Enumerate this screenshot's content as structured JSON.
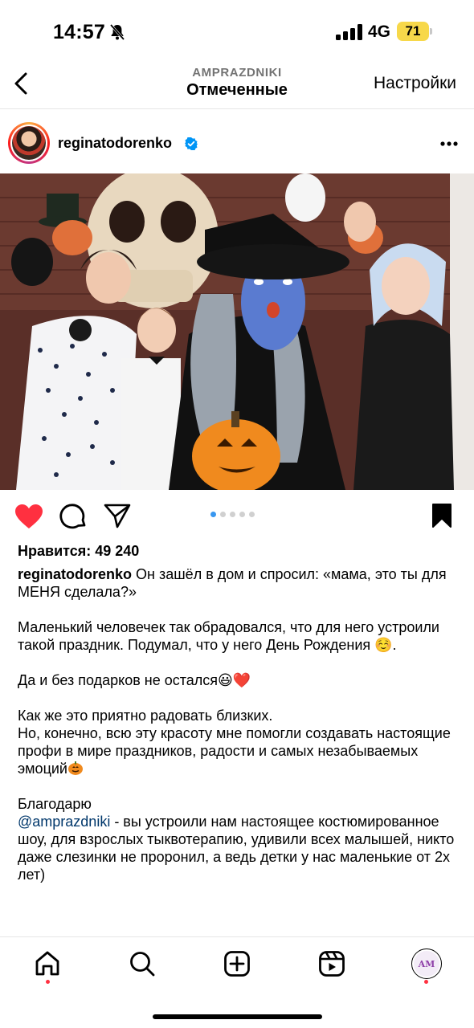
{
  "status_bar": {
    "time": "14:57",
    "network": "4G",
    "battery_level": "71",
    "icons": [
      "bell-slash-icon",
      "signal-bars-icon",
      "battery-icon"
    ],
    "battery_color": "#f7d84a"
  },
  "nav": {
    "subtitle": "AMPRAZDNIKI",
    "title": "Отмеченные",
    "settings_label": "Настройки"
  },
  "post": {
    "username": "reginatodorenko",
    "verified": true,
    "image_carousel": {
      "count": 5,
      "active_index": 0
    },
    "likes_text": "Нравится: 49 240",
    "caption_first": "Он зашёл в дом и спросил: «мама, это ты для МЕНЯ сделала?»",
    "caption_p2": "Маленький человечек так обрадовался, что для него устроили такой праздник. Подумал, что у него День Рождения ☺️.",
    "caption_p3": "Да и без подарков не остался😃❤️",
    "caption_p4_line1": "Как же это приятно радовать близких.",
    "caption_p4_line2": "Но, конечно, всю эту красоту мне помогли создавать настоящие профи в мире праздников, радости и самых незабываемых эмоций",
    "caption_p5_line1": "Благодарю",
    "caption_mention": "@amprazdniki",
    "caption_p5_rest": " - вы устроили нам настоящее костюмированное шоу, для взрослых тыквотерапию, удивили всех малышей, никто даже слезинки не проронил, а ведь детки у нас маленькие от 2х лет)",
    "liked": true
  },
  "colors": {
    "like_red": "#ff3040",
    "mention_blue": "#00376b",
    "verified_blue": "#0095f6",
    "active_dot": "#3897f0"
  },
  "tab_bar": {
    "tabs": [
      "home-icon",
      "search-icon",
      "create-icon",
      "reels-icon",
      "profile-avatar"
    ],
    "profile_initials": "AM"
  }
}
